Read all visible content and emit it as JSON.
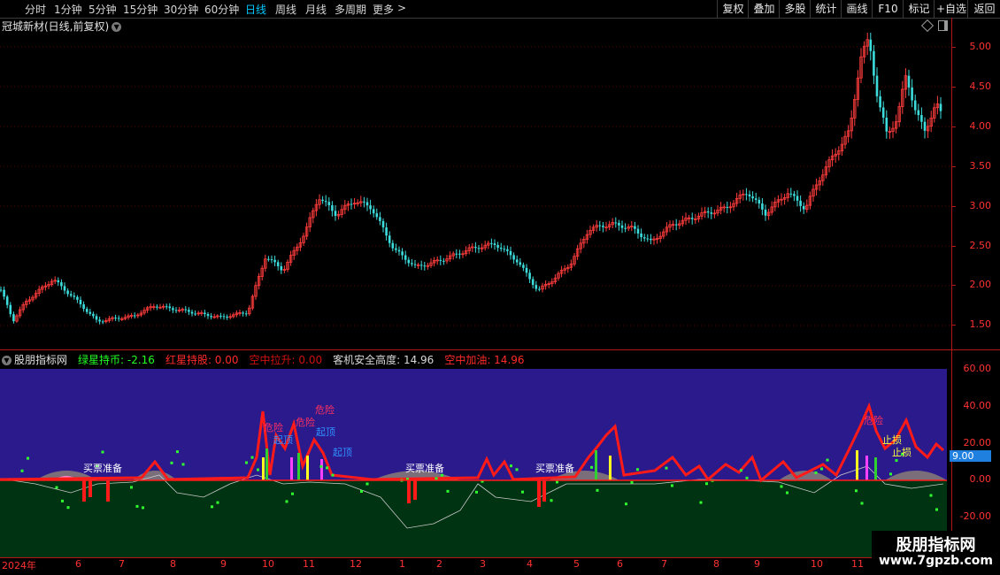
{
  "toolbar": {
    "periods": [
      "分时",
      "1分钟",
      "5分钟",
      "15分钟",
      "30分钟",
      "60分钟",
      "日线",
      "周线",
      "月线",
      "多周期",
      "更多"
    ],
    "active_period": "日线",
    "more_icon": "chevron-right-icon",
    "buttons": [
      "复权",
      "叠加",
      "多股",
      "统计",
      "画线",
      "F10",
      "标记",
      "+自选",
      "返回"
    ]
  },
  "stock": {
    "title": "冠城新材(日线,前复权)",
    "chevron_icon": "chevron-down-icon",
    "diamond_icon": "diamond-icon",
    "panel_icon": "panel-toggle-icon"
  },
  "indicator": {
    "name": "股朋指标网",
    "values": [
      {
        "label": "绿星持币: -2.16",
        "color": "#22ff22"
      },
      {
        "label": "红星持股: 0.00",
        "color": "#ff2a2a"
      },
      {
        "label": "空中拉升: 0.00",
        "color": "#cc1010"
      },
      {
        "label": "客机安全高度: 14.96",
        "color": "#d8d8d8"
      },
      {
        "label": "空中加油: 14.96",
        "color": "#ff2a2a"
      }
    ],
    "current_value": "9.00",
    "signals": [
      {
        "text": "买票准备",
        "color": "#ffffff"
      },
      {
        "text": "买票准备",
        "color": "#ffffff"
      },
      {
        "text": "买票准备",
        "color": "#ffffff"
      },
      {
        "text": "危险",
        "color": "#ff3060"
      },
      {
        "text": "危险",
        "color": "#ff3060"
      },
      {
        "text": "危险",
        "color": "#ff3060"
      },
      {
        "text": "危险",
        "color": "#ff3060"
      },
      {
        "text": "起顶",
        "color": "#3090ff"
      },
      {
        "text": "起顶",
        "color": "#3090ff"
      },
      {
        "text": "起顶",
        "color": "#3090ff"
      },
      {
        "text": "止损",
        "color": "#ffff40"
      },
      {
        "text": "止损",
        "color": "#ffff40"
      }
    ]
  },
  "price_axis": {
    "ticks": [
      "5.00",
      "4.50",
      "4.00",
      "3.50",
      "3.00",
      "2.50",
      "2.00",
      "1.50"
    ]
  },
  "indicator_axis": {
    "ticks": [
      "60.00",
      "40.00",
      "20.00",
      "0.00",
      "-20.00"
    ]
  },
  "time_axis": {
    "labels": [
      "2024年",
      "6",
      "7",
      "8",
      "9",
      "10",
      "11",
      "12",
      "1",
      "2",
      "3",
      "4",
      "5",
      "6",
      "7",
      "8",
      "9",
      "10",
      "11"
    ]
  },
  "watermark": {
    "title": "股朋指标网",
    "url": "www.7gpzb.com"
  },
  "colors": {
    "up": "#ff3c3c",
    "down": "#3cdcdc",
    "grid": "#5a0000",
    "axis": "#b01818",
    "sky": "#2a1a8c",
    "ground": "#003312"
  },
  "chart_data": {
    "type": "candlestick",
    "title": "冠城新材(日线,前复权)",
    "xlabel": "",
    "ylabel": "",
    "ylim": [
      1.35,
      5.2
    ],
    "x": [
      "2024-05",
      "2024-06",
      "2024-07",
      "2024-08",
      "2024-09",
      "2024-10",
      "2024-11",
      "2024-12",
      "2025-01",
      "2025-02",
      "2025-03",
      "2025-04",
      "2025-05",
      "2025-06",
      "2025-07",
      "2025-08",
      "2025-09",
      "2025-10",
      "2025-11"
    ],
    "close_monthly_approx": [
      1.6,
      2.05,
      1.65,
      1.7,
      1.6,
      3.1,
      3.0,
      2.3,
      2.4,
      2.5,
      2.4,
      1.95,
      2.6,
      2.7,
      2.8,
      2.95,
      3.2,
      3.5,
      4.2
    ],
    "indicator_ylim": [
      -25,
      65
    ],
    "indicator_series": [
      {
        "name": "客机安全高度",
        "last": 14.96
      },
      {
        "name": "空中加油",
        "last": 14.96
      },
      {
        "name": "绿星持币",
        "last": -2.16
      },
      {
        "name": "红星持股",
        "last": 0.0
      }
    ]
  }
}
